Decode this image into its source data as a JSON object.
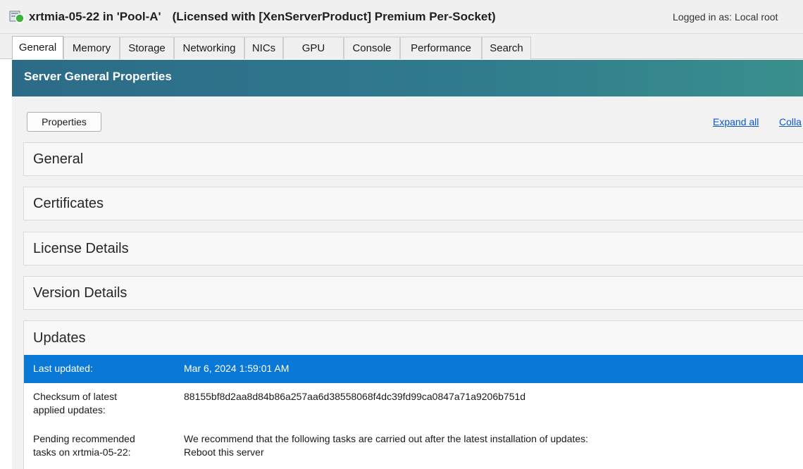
{
  "window": {
    "title": "xrtmia-05-22 in 'Pool-A'",
    "license": "(Licensed with [XenServerProduct] Premium Per-Socket)",
    "logged_in": "Logged in as:  Local root"
  },
  "tabs": [
    {
      "label": "General",
      "active": true
    },
    {
      "label": "Memory"
    },
    {
      "label": "Storage"
    },
    {
      "label": "Networking"
    },
    {
      "label": "NICs"
    },
    {
      "label": "GPU"
    },
    {
      "label": "Console"
    },
    {
      "label": "Performance"
    },
    {
      "label": "Search"
    }
  ],
  "header": {
    "title": "Server General Properties"
  },
  "toolbar": {
    "properties_label": "Properties",
    "expand_all": "Expand all",
    "collapse_all": "Colla"
  },
  "sections": [
    {
      "label": "General"
    },
    {
      "label": "Certificates"
    },
    {
      "label": "License Details"
    },
    {
      "label": "Version Details"
    }
  ],
  "updates": {
    "label": "Updates",
    "rows": [
      {
        "label": "Last updated:",
        "value": "Mar 6, 2024 1:59:01 AM",
        "selected": true
      },
      {
        "label_lines": [
          "Checksum of latest",
          "applied updates:"
        ],
        "value": "88155bf8d2aa8d84b86a257aa6d38558068f4dc39fd99ca0847a71a9206b751d"
      },
      {
        "label_lines": [
          "Pending recommended",
          "tasks on xrtmia-05-22:"
        ],
        "value_lines": [
          "We recommend that the following tasks are carried out after the latest installation of updates:",
          "Reboot this server"
        ]
      }
    ]
  },
  "colors": {
    "header_gradient_start": "#2c6b88",
    "header_gradient_end": "#398f8d",
    "selection": "#0a78d7",
    "link": "#0b57d0"
  }
}
